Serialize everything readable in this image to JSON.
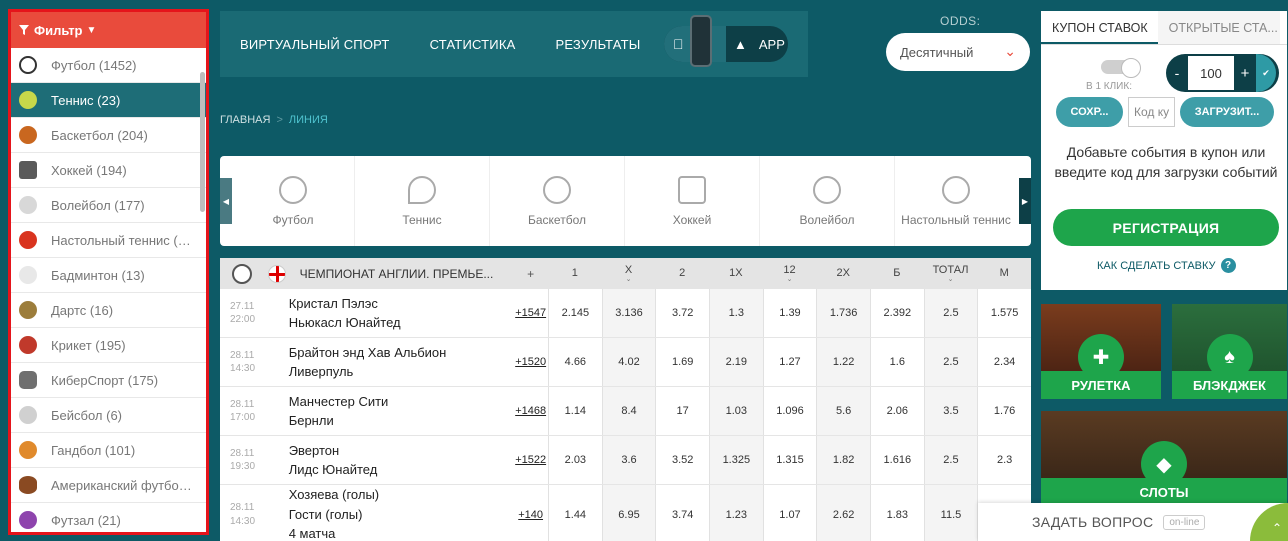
{
  "sidebar": {
    "filter_label": "Фильтр",
    "sports": [
      {
        "label": "Футбол (1452)",
        "color": "#ffffff",
        "icon": "football-icon"
      },
      {
        "label": "Теннис (23)",
        "color": "#c8d84a",
        "icon": "tennis-ball-icon"
      },
      {
        "label": "Баскетбол (204)",
        "color": "#c9671f",
        "icon": "basketball-icon"
      },
      {
        "label": "Хоккей (194)",
        "color": "#5a5a5a",
        "icon": "hockey-skate-icon"
      },
      {
        "label": "Волейбол (177)",
        "color": "#d8d8d8",
        "icon": "volleyball-icon"
      },
      {
        "label": "Настольный теннис (…",
        "color": "#d9341f",
        "icon": "table-tennis-icon"
      },
      {
        "label": "Бадминтон (13)",
        "color": "#e8e8e8",
        "icon": "badminton-icon"
      },
      {
        "label": "Дартс (16)",
        "color": "#9c7d3b",
        "icon": "darts-icon"
      },
      {
        "label": "Крикет (195)",
        "color": "#c0392b",
        "icon": "cricket-icon"
      },
      {
        "label": "КиберСпорт (175)",
        "color": "#6f6f6f",
        "icon": "gamepad-icon"
      },
      {
        "label": "Бейсбол (6)",
        "color": "#d0d0d0",
        "icon": "baseball-icon"
      },
      {
        "label": "Гандбол (101)",
        "color": "#e08a2c",
        "icon": "handball-icon"
      },
      {
        "label": "Американский футбо…",
        "color": "#8a4a22",
        "icon": "american-football-icon"
      },
      {
        "label": "Футзал (21)",
        "color": "#8e44ad",
        "icon": "futsal-icon"
      }
    ]
  },
  "nav": {
    "virtual": "ВИРТУАЛЬНЫЙ СПОРТ",
    "stats": "СТАТИСТИКА",
    "results": "РЕЗУЛЬТАТЫ",
    "app": "APP"
  },
  "odds": {
    "label": "ODDS:",
    "selected": "Десятичный"
  },
  "breadcrumb": {
    "home": "ГЛАВНАЯ",
    "current": "ЛИНИЯ"
  },
  "carousel": [
    {
      "label": "Футбол",
      "icon": "football-icon"
    },
    {
      "label": "Теннис",
      "icon": "tennis-racket-icon"
    },
    {
      "label": "Баскетбол",
      "icon": "basketball-icon"
    },
    {
      "label": "Хоккей",
      "icon": "hockey-icon"
    },
    {
      "label": "Волейбол",
      "icon": "volleyball-icon"
    },
    {
      "label": "Настольный теннис",
      "icon": "table-tennis-icon"
    }
  ],
  "table": {
    "league": "ЧЕМПИОНАТ АНГЛИИ. ПРЕМЬЕ...",
    "plus": "+",
    "columns": [
      "1",
      "X",
      "2",
      "1X",
      "12",
      "2X",
      "Б",
      "ТОТАЛ",
      "М"
    ],
    "rows": [
      {
        "date": "27.11",
        "time": "22:00",
        "team1": "Кристал Пэлэс",
        "team2": "Ньюкасл Юнайтед",
        "team3": "",
        "more": "+1547",
        "odds": [
          "2.145",
          "3.136",
          "3.72",
          "1.3",
          "1.39",
          "1.736",
          "2.392",
          "2.5",
          "1.575"
        ]
      },
      {
        "date": "28.11",
        "time": "14:30",
        "team1": "Брайтон энд Хав Альбион",
        "team2": "Ливерпуль",
        "team3": "",
        "more": "+1520",
        "odds": [
          "4.66",
          "4.02",
          "1.69",
          "2.19",
          "1.27",
          "1.22",
          "1.6",
          "2.5",
          "2.34"
        ]
      },
      {
        "date": "28.11",
        "time": "17:00",
        "team1": "Манчестер Сити",
        "team2": "Бернли",
        "team3": "",
        "more": "+1468",
        "odds": [
          "1.14",
          "8.4",
          "17",
          "1.03",
          "1.096",
          "5.6",
          "2.06",
          "3.5",
          "1.76"
        ]
      },
      {
        "date": "28.11",
        "time": "19:30",
        "team1": "Эвертон",
        "team2": "Лидс Юнайтед",
        "team3": "",
        "more": "+1522",
        "odds": [
          "2.03",
          "3.6",
          "3.52",
          "1.325",
          "1.315",
          "1.82",
          "1.616",
          "2.5",
          "2.3"
        ]
      },
      {
        "date": "28.11",
        "time": "14:30",
        "team1": "Хозяева (голы)",
        "team2": "Гости (голы)",
        "team3": "4 матча",
        "more": "+140",
        "odds": [
          "1.44",
          "6.95",
          "3.74",
          "1.23",
          "1.07",
          "2.62",
          "1.83",
          "11.5",
          ""
        ]
      }
    ]
  },
  "coupon": {
    "tab_active": "КУПОН СТАВОК",
    "tab_other": "ОТКРЫТЫЕ СТА...",
    "oneclick": "В 1 КЛИК:",
    "minus": "-",
    "amount": "100",
    "plus": "+",
    "save": "СОХР...",
    "code_placeholder": "Код ку",
    "load": "ЗАГРУЗИТ...",
    "info": "Добавьте события в купон или введите код для загрузки событий",
    "register": "РЕГИСТРАЦИЯ",
    "howto": "КАК СДЕЛАТЬ СТАВКУ"
  },
  "tiles": {
    "roulette": "РУЛЕТКА",
    "blackjack": "БЛЭКДЖЕК",
    "slots": "СЛОТЫ"
  },
  "ask": {
    "label": "ЗАДАТЬ ВОПРОС",
    "status": "on-line"
  },
  "colors": {
    "background": "#0d5a66",
    "filter_header": "#e94b3c",
    "active_item": "#1e6d77",
    "register": "#1ea54b",
    "highlight_border": "#e5141b"
  }
}
